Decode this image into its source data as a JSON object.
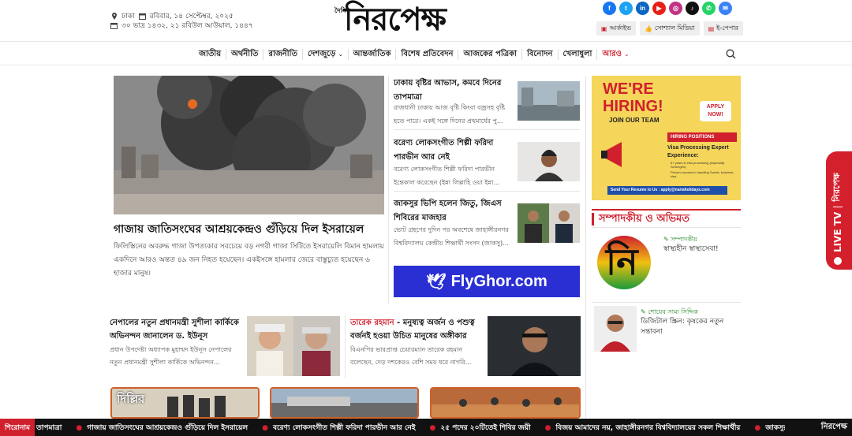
{
  "header": {
    "location": "ঢাকা",
    "date_bn": "রবিবার, ১৪ সেপ্টেম্বর, ২০২৫",
    "date_alt": "৩০ ভাদ্র ১৪৩২, ২১ রবিউল আউয়াল, ১৪৪৭",
    "logo_small": "দৈনিক",
    "logo_big": "নিরপেক্ষ",
    "social_icons": [
      "facebook-icon",
      "twitter-icon",
      "linkedin-icon",
      "youtube-icon",
      "instagram-icon",
      "tiktok-icon",
      "whatsapp-icon",
      "messenger-icon"
    ],
    "buttons": [
      "আর্কাইভ",
      "সোশ্যাল মিডিয়া",
      "ই-পেপার"
    ]
  },
  "nav": {
    "items": [
      "জাতীয়",
      "অর্থনীতি",
      "রাজনীতি",
      "দেশজুড়ে",
      "আন্তর্জাতিক",
      "বিশেষ প্রতিবেদন",
      "আজকের পত্রিকা",
      "বিনোদন",
      "খেলাধুলা",
      "আরও"
    ]
  },
  "lead": {
    "title": "গাজায় জাতিসংঘের আশ্রয়কেন্দ্রও গুঁড়িয়ে দিল ইসরায়েল",
    "summary": "ফিলিস্তিনের অবরুদ্ধ গাজা উপত্যকার সবচেয়ে বড় নগরী গাজা সিটিতে ইসরায়েলি বিমান হামলায় একদিনে আরও অন্তত ৪৯ জন নিহত হয়েছেন। একইসঙ্গে হামলার জেরে বাস্তুচ্যুত হয়েছেন ৬ হাজার মানুষ।"
  },
  "side_news": [
    {
      "title": "ঢাকায় বৃষ্টির আভাস, কমবে দিনের তাপমাত্রা",
      "summary": "রাজধানী ঢাকায় আজ বৃষ্টি কিংবা বজ্রসহ বৃষ্টি হতে পারে। একই সঙ্গে দিনের প্রথমার্ধের পু..."
    },
    {
      "title": "বরেণ্য লোকসংগীত শিল্পী ফরিদা পারভীন আর নেই",
      "summary": "বরেণ্য লোকসংগীত শিল্পী ফরিদা পারভীন ইন্তেকাল করেছেন (ইন্না লিল্লাহি ওয়া ইন্না..."
    },
    {
      "title": "জাকসুর ভিপি হলেন জিতু, জিএস শিবিরের মাজহার",
      "summary": "ভোট গ্রহণের দুদিন পর অবশেষে জাহাঙ্গীরনগর বিশ্ববিদ্যালয় কেন্দ্রীয় শিক্ষার্থী সংসদ (জাকসু)..."
    }
  ],
  "ad_flyghor": "FlyGhor.com",
  "hiring_ad": {
    "headline": "WE'RE HIRING!",
    "sub": "JOIN OUR TEAM",
    "apply": "APPLY NOW!",
    "positions_label": "HIRING POSITIONS",
    "role": "Visa Processing Expert",
    "exp_label": "Experience:",
    "exp1": "5+ years in visa processing (especially Schengen).",
    "exp2": "Proven success in handling Tourist, business visa.",
    "footer": "Send Your Resume to Us :  apply@nariaholidays.com"
  },
  "opinion": {
    "heading": "সম্পাদকীয় ও অভিমত",
    "items": [
      {
        "author": "সম্পাদকীয়",
        "title": "স্বাস্থ্যহীন স্বাস্থ্যসেবা!",
        "logo": "নি"
      },
      {
        "author": "শোয়েব সাম্য সিদ্দিক",
        "title": "ডিজিটাল স্ক্রিন: কৃষকের নতুন সন্তাবনা"
      }
    ]
  },
  "bottom_news": [
    {
      "title": "নেপালের নতুন প্রধানমন্ত্রী সুশীলা কার্কিকে অভিনন্দন জানালেন ড. ইউনূস",
      "summary": "প্রধান উপদেষ্টা অধ্যাপক মুহাম্মদ ইউনূস নেপালের নতুন প্রধানমন্ত্রী সুশীলা কার্কিকে অভিনন্দন..."
    },
    {
      "title_highlight": "তারেক রহমান",
      "title": " - মনুষ্যত্ব অর্জন ও পশুত্ব বর্জনই হওয়া উচিত মানুষের অঙ্গীকার",
      "summary": "বিএনপির ভারপ্রাপ্ত চেয়ারম্যান তারেক রহমান বলেছেন, দেড় দশকেরও বেশি সময় ধরে নাগরি..."
    }
  ],
  "bottom_cards": [
    "দিল্লির"
  ],
  "live_tv": {
    "label": "LIVE TV",
    "brand": "নিরপেক্ষ"
  },
  "ticker": {
    "label": "শিরোনাম",
    "items": [
      "তাপমাত্রা",
      "গাজায় জাতিসংঘের আশ্রয়কেন্দ্রও গুঁড়িয়ে দিল ইসরায়েল",
      "বরেণ্য লোকসংগীত শিল্পী ফরিদা পারভীন আর নেই",
      "২৫ পদের ২০টিতেই শিবির জয়ী",
      "বিজয় আমাদের নয়, জাহাঙ্গীরনগর বিশ্ববিদ্যালয়ের সকল শিক্ষার্থীর",
      "জাকসুর ভিপি হলেন জিতু, জিএস শিবিরের মাজহার"
    ],
    "brand": "নিরপেক্ষ"
  },
  "colors": {
    "accent": "#d0202e",
    "flyghor": "#2a2fd4",
    "hiring_bg": "#f5d55a"
  }
}
